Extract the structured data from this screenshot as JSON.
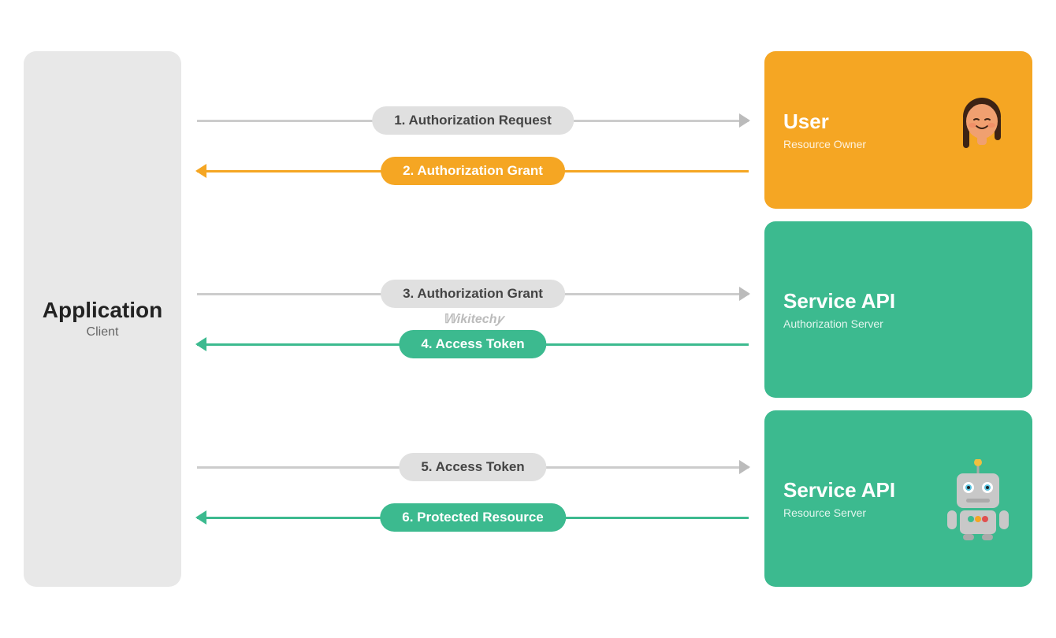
{
  "app_client": {
    "title": "Application",
    "subtitle": "Client"
  },
  "flows": [
    {
      "id": "flow1",
      "arrows": [
        {
          "id": "arrow1",
          "label": "1. Authorization Request",
          "direction": "right",
          "style": "gray"
        },
        {
          "id": "arrow2",
          "label": "2. Authorization Grant",
          "direction": "left",
          "style": "orange"
        }
      ]
    },
    {
      "id": "flow2",
      "arrows": [
        {
          "id": "arrow3",
          "label": "3. Authorization Grant",
          "direction": "right",
          "style": "gray"
        },
        {
          "id": "arrow4",
          "label": "4. Access Token",
          "direction": "left",
          "style": "green"
        }
      ]
    },
    {
      "id": "flow3",
      "arrows": [
        {
          "id": "arrow5",
          "label": "5. Access Token",
          "direction": "right",
          "style": "gray"
        },
        {
          "id": "arrow6",
          "label": "6. Protected Resource",
          "direction": "left",
          "style": "green"
        }
      ]
    }
  ],
  "panels": {
    "user": {
      "title": "User",
      "subtitle": "Resource Owner"
    },
    "auth_server": {
      "title": "Service API",
      "subtitle": "Authorization Server"
    },
    "resource_server": {
      "title": "Service API",
      "subtitle": "Resource Server"
    }
  },
  "watermark": "Wikitech"
}
